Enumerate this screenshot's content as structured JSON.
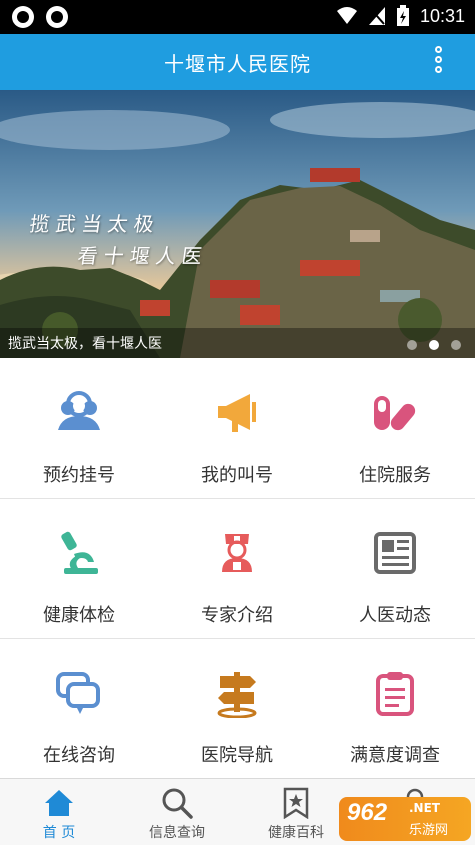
{
  "status_bar": {
    "time": "10:31"
  },
  "app_bar": {
    "title": "十堰市人民医院"
  },
  "banner": {
    "slogan_line1": "揽武当太极",
    "slogan_line2": "看十堰人医",
    "caption": "揽武当太极，看十堰人医",
    "active_index": 1,
    "slide_count": 3
  },
  "grid": {
    "items": [
      {
        "label": "预约挂号",
        "icon": "doctors-icon",
        "color": "#5b8fd0"
      },
      {
        "label": "我的叫号",
        "icon": "megaphone-icon",
        "color": "#f2a83b"
      },
      {
        "label": "住院服务",
        "icon": "pills-icon",
        "color": "#d9547d"
      },
      {
        "label": "健康体检",
        "icon": "microscope-icon",
        "color": "#3eb596"
      },
      {
        "label": "专家介绍",
        "icon": "nurse-icon",
        "color": "#e65b5b"
      },
      {
        "label": "人医动态",
        "icon": "newspaper-icon",
        "color": "#6a6a6a"
      },
      {
        "label": "在线咨询",
        "icon": "chat-icon",
        "color": "#5b8fd0"
      },
      {
        "label": "医院导航",
        "icon": "signpost-icon",
        "color": "#c67a1e"
      },
      {
        "label": "满意度调查",
        "icon": "clipboard-icon",
        "color": "#d9547d"
      }
    ]
  },
  "tab_bar": {
    "tabs": [
      {
        "label": "首 页",
        "icon": "home-icon"
      },
      {
        "label": "信息查询",
        "icon": "search-icon"
      },
      {
        "label": "健康百科",
        "icon": "bookmark-star-icon"
      },
      {
        "label": "",
        "icon": "person-icon"
      }
    ],
    "active": 0
  },
  "watermark": {
    "number": "962",
    "domain": ".NET",
    "name": "乐游网"
  }
}
